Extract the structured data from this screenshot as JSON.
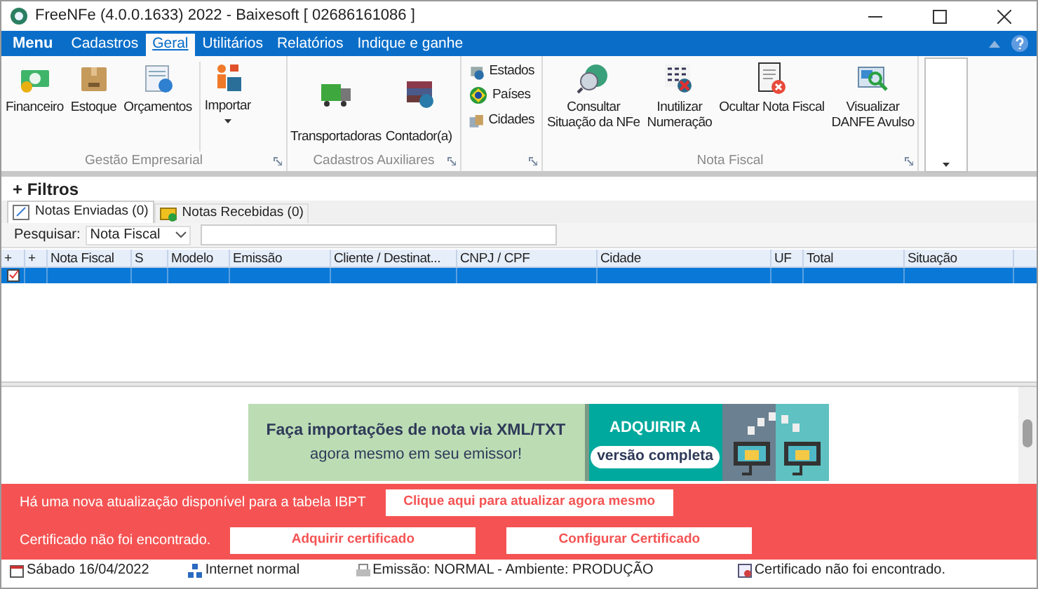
{
  "window": {
    "title": "FreeNFe (4.0.0.1633) 2022 - Baixesoft [ 02686161086 ]"
  },
  "menu_tabs": [
    {
      "label": "Menu",
      "kind": "app",
      "selected": false
    },
    {
      "label": "Cadastros",
      "kind": "tab",
      "selected": false
    },
    {
      "label": "Geral",
      "kind": "tab",
      "selected": true
    },
    {
      "label": "Utilitários",
      "kind": "tab",
      "selected": false
    },
    {
      "label": "Relatórios",
      "kind": "tab",
      "selected": false
    },
    {
      "label": "Indique e ganhe",
      "kind": "tab",
      "selected": false
    }
  ],
  "ribbon_groups": [
    {
      "label": "Gestão Empresarial",
      "buttons": [
        {
          "label": "Financeiro",
          "kind": "large"
        },
        {
          "label": "Estoque",
          "kind": "large"
        },
        {
          "label": "Orçamentos",
          "kind": "large"
        },
        {
          "label": "Importar",
          "kind": "dropdown"
        }
      ]
    },
    {
      "label": "Cadastros Auxiliares",
      "buttons": [
        {
          "label": "Transportadoras",
          "kind": "low"
        },
        {
          "label": "Contador(a)",
          "kind": "low"
        }
      ]
    },
    {
      "buttons": [
        {
          "label": "Estados",
          "kind": "small"
        },
        {
          "label": "Países",
          "kind": "small"
        },
        {
          "label": "Cidades",
          "kind": "small"
        }
      ]
    },
    {
      "label": "Nota Fiscal",
      "buttons": [
        {
          "label": "Consultar\nSituação da NFe",
          "kind": "large"
        },
        {
          "label": "Inutilizar\nNumeração",
          "kind": "large"
        },
        {
          "label": "Ocultar Nota Fiscal",
          "kind": "large"
        },
        {
          "label": "Visualizar\nDANFE Avulso",
          "kind": "large"
        }
      ]
    }
  ],
  "filters": {
    "label": "+ Filtros"
  },
  "note_tabs": [
    {
      "label": "Notas Enviadas (0)",
      "selected": true
    },
    {
      "label": "Notas Recebidas (0)",
      "selected": false
    }
  ],
  "search": {
    "label": "Pesquisar:",
    "field": "Nota Fiscal"
  },
  "table": {
    "columns": [
      "+",
      "+",
      "Nota Fiscal",
      "S",
      "Modelo",
      "Emissão",
      "Cliente / Destinat...",
      "CNPJ / CPF",
      "Cidade",
      "UF",
      "Total",
      "Situação"
    ],
    "rows": [
      {
        "selected": true
      }
    ]
  },
  "banner": {
    "headline": "Faça importações de nota via XML/TXT",
    "subline": "agora mesmo em seu emissor!",
    "cta_top": "ADQUIRIR A",
    "cta_button": "versão completa"
  },
  "alerts": [
    {
      "message": "Há uma nova atualização disponível para a tabela IBPT",
      "buttons": [
        "Clique aqui para atualizar agora mesmo"
      ]
    },
    {
      "message": "Certificado não foi encontrado.",
      "buttons": [
        "Adquirir certificado",
        "Configurar Certificado"
      ]
    }
  ],
  "status_bar": [
    "Sábado 16/04/2022",
    "Internet normal",
    "Emissão: NORMAL - Ambiente: PRODUÇÃO",
    "Certificado não foi encontrado."
  ]
}
